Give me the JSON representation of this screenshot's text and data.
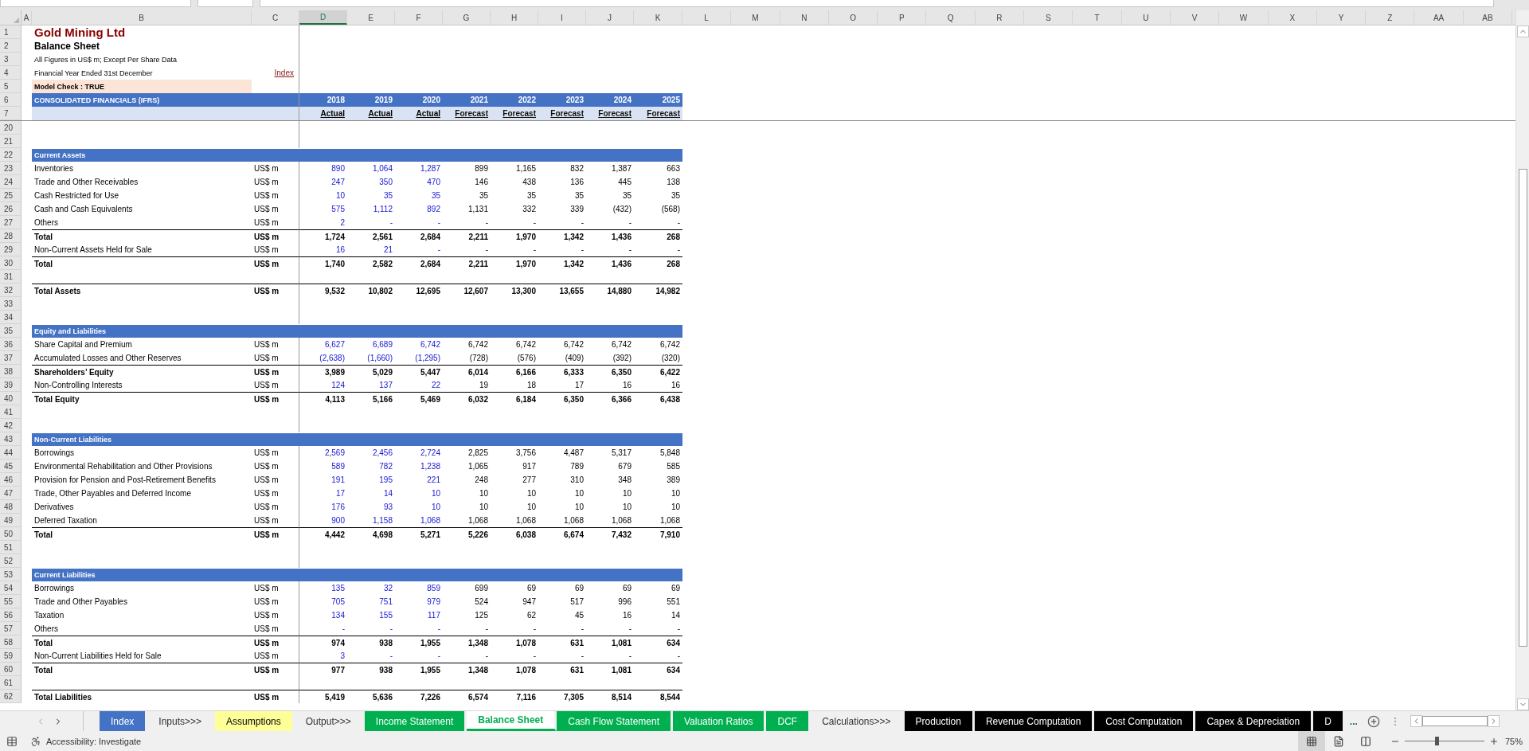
{
  "column_letters": [
    {
      "label": "A",
      "selected": false
    },
    {
      "label": "B",
      "selected": false
    },
    {
      "label": "C",
      "selected": false
    },
    {
      "label": "D",
      "selected": true
    },
    {
      "label": "E",
      "selected": false
    },
    {
      "label": "F",
      "selected": false
    },
    {
      "label": "G",
      "selected": false
    },
    {
      "label": "H",
      "selected": false
    },
    {
      "label": "I",
      "selected": false
    },
    {
      "label": "J",
      "selected": false
    },
    {
      "label": "K",
      "selected": false
    },
    {
      "label": "L",
      "selected": false
    },
    {
      "label": "M",
      "selected": false
    },
    {
      "label": "N",
      "selected": false
    },
    {
      "label": "O",
      "selected": false
    },
    {
      "label": "P",
      "selected": false
    },
    {
      "label": "Q",
      "selected": false
    },
    {
      "label": "R",
      "selected": false
    },
    {
      "label": "S",
      "selected": false
    },
    {
      "label": "T",
      "selected": false
    },
    {
      "label": "U",
      "selected": false
    },
    {
      "label": "V",
      "selected": false
    },
    {
      "label": "W",
      "selected": false
    },
    {
      "label": "X",
      "selected": false
    },
    {
      "label": "Y",
      "selected": false
    },
    {
      "label": "Z",
      "selected": false
    },
    {
      "label": "AA",
      "selected": false
    },
    {
      "label": "AB",
      "selected": false
    }
  ],
  "columns": [
    {
      "year": "2018",
      "basis": "Actual",
      "kind": "actual"
    },
    {
      "year": "2019",
      "basis": "Actual",
      "kind": "actual"
    },
    {
      "year": "2020",
      "basis": "Actual",
      "kind": "actual"
    },
    {
      "year": "2021",
      "basis": "Forecast",
      "kind": "forecast"
    },
    {
      "year": "2022",
      "basis": "Forecast",
      "kind": "forecast"
    },
    {
      "year": "2023",
      "basis": "Forecast",
      "kind": "forecast"
    },
    {
      "year": "2024",
      "basis": "Forecast",
      "kind": "forecast"
    },
    {
      "year": "2025",
      "basis": "Forecast",
      "kind": "forecast"
    }
  ],
  "header_rows": [
    {
      "num": "1",
      "kind": "title",
      "label": "Gold Mining Ltd"
    },
    {
      "num": "2",
      "kind": "subtitle",
      "label": "Balance Sheet"
    },
    {
      "num": "3",
      "kind": "note",
      "label": "All Figures in US$ m; Except Per Share Data"
    },
    {
      "num": "4",
      "kind": "note",
      "label": "Financial Year Ended 31st December",
      "link": "Index"
    },
    {
      "num": "5",
      "kind": "check",
      "label": "Model Check : TRUE"
    },
    {
      "num": "6",
      "kind": "years",
      "label": "CONSOLIDATED FINANCIALS (IFRS)"
    },
    {
      "num": "7",
      "kind": "basis"
    }
  ],
  "rows": [
    {
      "num": "20",
      "kind": "blank"
    },
    {
      "num": "21",
      "kind": "blank"
    },
    {
      "num": "22",
      "kind": "section",
      "label": "Current Assets"
    },
    {
      "num": "23",
      "kind": "item",
      "label": "Inventories",
      "unit": "US$ m",
      "values": [
        "890",
        "1,064",
        "1,287",
        "899",
        "1,165",
        "832",
        "1,387",
        "663"
      ]
    },
    {
      "num": "24",
      "kind": "item",
      "label": "Trade and Other Receivables",
      "unit": "US$ m",
      "values": [
        "247",
        "350",
        "470",
        "146",
        "438",
        "136",
        "445",
        "138"
      ]
    },
    {
      "num": "25",
      "kind": "item",
      "label": "Cash Restricted for Use",
      "unit": "US$ m",
      "values": [
        "10",
        "35",
        "35",
        "35",
        "35",
        "35",
        "35",
        "35"
      ]
    },
    {
      "num": "26",
      "kind": "item",
      "label": "Cash and Cash Equivalents",
      "unit": "US$ m",
      "values": [
        "575",
        "1,112",
        "892",
        "1,131",
        "332",
        "339",
        "(432)",
        "(568)"
      ]
    },
    {
      "num": "27",
      "kind": "item",
      "label": "Others",
      "unit": "US$ m",
      "values": [
        "2",
        "-",
        "-",
        "-",
        "-",
        "-",
        "-",
        "-"
      ]
    },
    {
      "num": "28",
      "kind": "total",
      "label": "Total",
      "unit": "US$ m",
      "values": [
        "1,724",
        "2,561",
        "2,684",
        "2,211",
        "1,970",
        "1,342",
        "1,436",
        "268"
      ]
    },
    {
      "num": "29",
      "kind": "item",
      "label": "Non-Current Assets Held for Sale",
      "unit": "US$ m",
      "values": [
        "16",
        "21",
        "-",
        "-",
        "-",
        "-",
        "-",
        "-"
      ]
    },
    {
      "num": "30",
      "kind": "total",
      "label": "Total",
      "unit": "US$ m",
      "values": [
        "1,740",
        "2,582",
        "2,684",
        "2,211",
        "1,970",
        "1,342",
        "1,436",
        "268"
      ]
    },
    {
      "num": "31",
      "kind": "blank"
    },
    {
      "num": "32",
      "kind": "total",
      "label": "Total Assets",
      "unit": "US$ m",
      "values": [
        "9,532",
        "10,802",
        "12,695",
        "12,607",
        "13,300",
        "13,655",
        "14,880",
        "14,982"
      ]
    },
    {
      "num": "33",
      "kind": "blank"
    },
    {
      "num": "34",
      "kind": "blank"
    },
    {
      "num": "35",
      "kind": "section",
      "label": "Equity and Liabilities"
    },
    {
      "num": "36",
      "kind": "item",
      "label": "Share Capital and Premium",
      "unit": "US$ m",
      "values": [
        "6,627",
        "6,689",
        "6,742",
        "6,742",
        "6,742",
        "6,742",
        "6,742",
        "6,742"
      ]
    },
    {
      "num": "37",
      "kind": "item",
      "label": "Accumulated Losses and Other Reserves",
      "unit": "US$ m",
      "values": [
        "(2,638)",
        "(1,660)",
        "(1,295)",
        "(728)",
        "(576)",
        "(409)",
        "(392)",
        "(320)"
      ]
    },
    {
      "num": "38",
      "kind": "total",
      "label": "Shareholders’ Equity",
      "unit": "US$ m",
      "values": [
        "3,989",
        "5,029",
        "5,447",
        "6,014",
        "6,166",
        "6,333",
        "6,350",
        "6,422"
      ]
    },
    {
      "num": "39",
      "kind": "item",
      "label": "Non-Controlling Interests",
      "unit": "US$ m",
      "values": [
        "124",
        "137",
        "22",
        "19",
        "18",
        "17",
        "16",
        "16"
      ]
    },
    {
      "num": "40",
      "kind": "total",
      "label": "Total Equity",
      "unit": "US$ m",
      "values": [
        "4,113",
        "5,166",
        "5,469",
        "6,032",
        "6,184",
        "6,350",
        "6,366",
        "6,438"
      ]
    },
    {
      "num": "41",
      "kind": "blank"
    },
    {
      "num": "42",
      "kind": "blank"
    },
    {
      "num": "43",
      "kind": "section",
      "label": "Non-Current Liabilities"
    },
    {
      "num": "44",
      "kind": "item",
      "label": "Borrowings",
      "unit": "US$ m",
      "values": [
        "2,569",
        "2,456",
        "2,724",
        "2,825",
        "3,756",
        "4,487",
        "5,317",
        "5,848"
      ]
    },
    {
      "num": "45",
      "kind": "item",
      "label": "Environmental Rehabilitation and Other Provisions",
      "unit": "US$ m",
      "values": [
        "589",
        "782",
        "1,238",
        "1,065",
        "917",
        "789",
        "679",
        "585"
      ]
    },
    {
      "num": "46",
      "kind": "item",
      "label": "Provision for Pension and Post-Retirement Benefits",
      "unit": "US$ m",
      "values": [
        "191",
        "195",
        "221",
        "248",
        "277",
        "310",
        "348",
        "389"
      ]
    },
    {
      "num": "47",
      "kind": "item",
      "label": "Trade, Other Payables and Deferred Income",
      "unit": "US$ m",
      "values": [
        "17",
        "14",
        "10",
        "10",
        "10",
        "10",
        "10",
        "10"
      ]
    },
    {
      "num": "48",
      "kind": "item",
      "label": "Derivatives",
      "unit": "US$ m",
      "values": [
        "176",
        "93",
        "10",
        "10",
        "10",
        "10",
        "10",
        "10"
      ]
    },
    {
      "num": "49",
      "kind": "item",
      "label": "Deferred Taxation",
      "unit": "US$ m",
      "values": [
        "900",
        "1,158",
        "1,068",
        "1,068",
        "1,068",
        "1,068",
        "1,068",
        "1,068"
      ]
    },
    {
      "num": "50",
      "kind": "total",
      "label": "Total",
      "unit": "US$ m",
      "values": [
        "4,442",
        "4,698",
        "5,271",
        "5,226",
        "6,038",
        "6,674",
        "7,432",
        "7,910"
      ]
    },
    {
      "num": "51",
      "kind": "blank"
    },
    {
      "num": "52",
      "kind": "blank"
    },
    {
      "num": "53",
      "kind": "section",
      "label": "Current Liabilities"
    },
    {
      "num": "54",
      "kind": "item",
      "label": "Borrowings",
      "unit": "US$ m",
      "values": [
        "135",
        "32",
        "859",
        "699",
        "69",
        "69",
        "69",
        "69"
      ]
    },
    {
      "num": "55",
      "kind": "item",
      "label": "Trade and Other Payables",
      "unit": "US$ m",
      "values": [
        "705",
        "751",
        "979",
        "524",
        "947",
        "517",
        "996",
        "551"
      ]
    },
    {
      "num": "56",
      "kind": "item",
      "label": "Taxation",
      "unit": "US$ m",
      "values": [
        "134",
        "155",
        "117",
        "125",
        "62",
        "45",
        "16",
        "14"
      ]
    },
    {
      "num": "57",
      "kind": "item",
      "label": "Others",
      "unit": "US$ m",
      "values": [
        "-",
        "-",
        "-",
        "-",
        "-",
        "-",
        "-",
        "-"
      ]
    },
    {
      "num": "58",
      "kind": "total",
      "label": "Total",
      "unit": "US$ m",
      "values": [
        "974",
        "938",
        "1,955",
        "1,348",
        "1,078",
        "631",
        "1,081",
        "634"
      ]
    },
    {
      "num": "59",
      "kind": "item",
      "label": "Non-Current Liabilities Held for Sale",
      "unit": "US$ m",
      "values": [
        "3",
        "-",
        "-",
        "-",
        "-",
        "-",
        "-",
        "-"
      ]
    },
    {
      "num": "60",
      "kind": "total",
      "label": "Total",
      "unit": "US$ m",
      "values": [
        "977",
        "938",
        "1,955",
        "1,348",
        "1,078",
        "631",
        "1,081",
        "634"
      ]
    },
    {
      "num": "61",
      "kind": "blank"
    },
    {
      "num": "62",
      "kind": "total",
      "label": "Total Liabilities",
      "unit": "US$ m",
      "values": [
        "5,419",
        "5,636",
        "7,226",
        "6,574",
        "7,116",
        "7,305",
        "8,514",
        "8,544"
      ]
    }
  ],
  "sheet_tabs": [
    {
      "label": "Index",
      "color": "#4472c4",
      "selected": false
    },
    {
      "label": "Inputs>>>",
      "selected": false
    },
    {
      "label": "Assumptions",
      "color": "#ffff99",
      "selected": false
    },
    {
      "label": "Output>>>",
      "selected": false
    },
    {
      "label": "Income Statement",
      "color": "#00b050",
      "selected": false
    },
    {
      "label": "Balance Sheet",
      "color": "#00b050",
      "selected": true
    },
    {
      "label": "Cash Flow Statement",
      "color": "#00b050",
      "selected": false
    },
    {
      "label": "Valuation Ratios",
      "color": "#00b050",
      "selected": false
    },
    {
      "label": "DCF",
      "color": "#00b050",
      "selected": false
    },
    {
      "label": "Calculations>>>",
      "selected": false
    },
    {
      "label": "Production",
      "color": "#000000",
      "selected": false
    },
    {
      "label": "Revenue Computation",
      "color": "#000000",
      "selected": false
    },
    {
      "label": "Cost Computation",
      "color": "#000000",
      "selected": false
    },
    {
      "label": "Capex & Depreciation",
      "color": "#000000",
      "selected": false
    },
    {
      "label": "D",
      "color": "#000000",
      "selected": false
    }
  ],
  "more_tabs": "...",
  "status_bar": {
    "accessibility": "Accessibility: Investigate",
    "views": [
      {
        "kind": "normal",
        "selected": true
      },
      {
        "kind": "page-layout",
        "selected": false
      },
      {
        "kind": "page-break",
        "selected": false
      }
    ],
    "zoom": {
      "level": 0.4,
      "reading": "75%"
    }
  }
}
